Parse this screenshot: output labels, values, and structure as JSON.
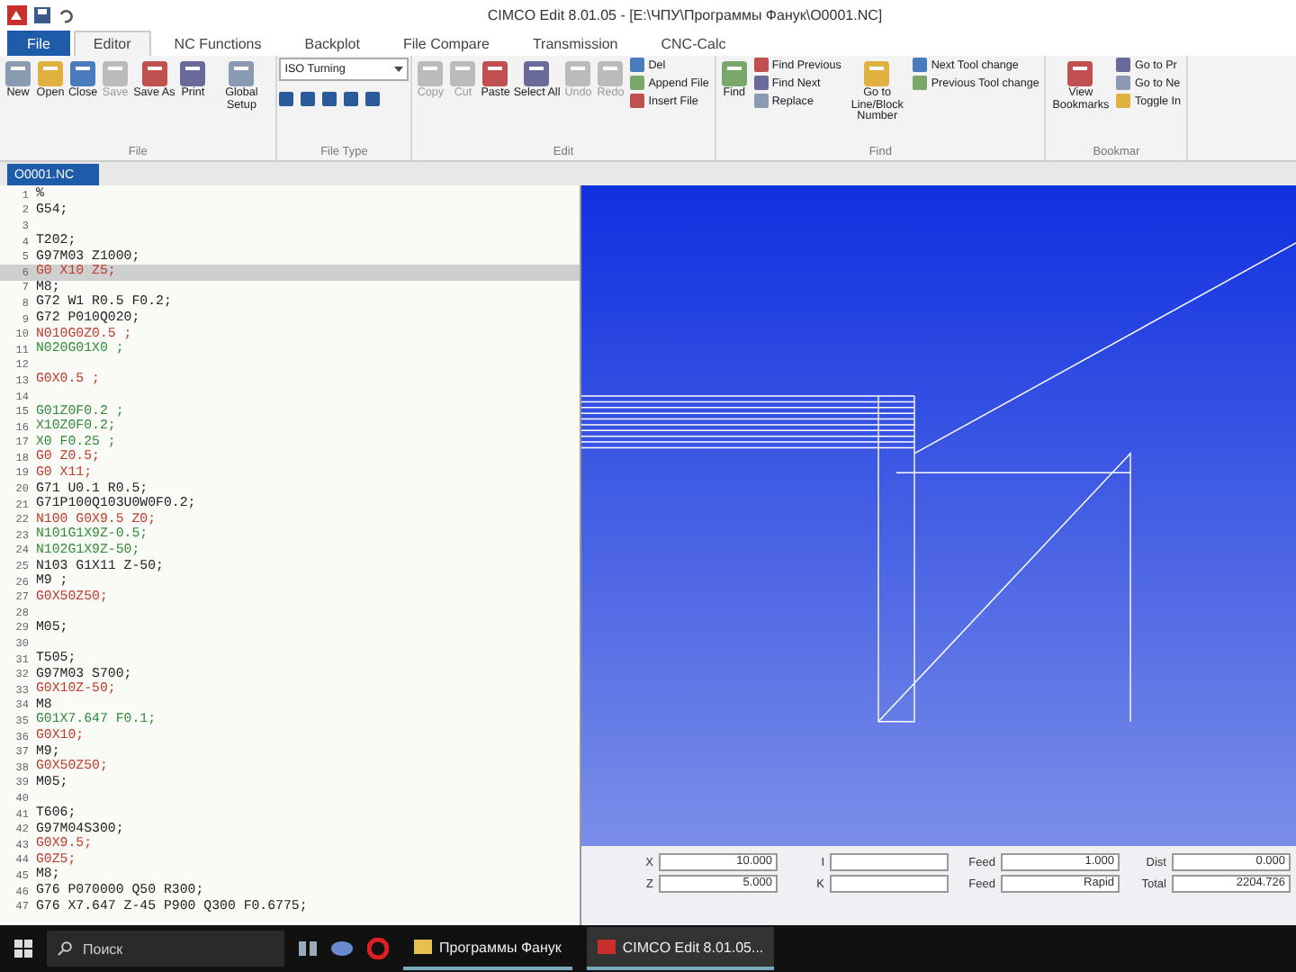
{
  "window": {
    "title": "CIMCO Edit 8.01.05 - [E:\\ЧПУ\\Программы Фанук\\O0001.NC]"
  },
  "tabs": [
    {
      "label": "File",
      "selected": false,
      "kind": "file"
    },
    {
      "label": "Editor",
      "selected": true,
      "kind": "tab"
    },
    {
      "label": "NC Functions",
      "selected": false,
      "kind": "tab"
    },
    {
      "label": "Backplot",
      "selected": false,
      "kind": "tab"
    },
    {
      "label": "File Compare",
      "selected": false,
      "kind": "tab"
    },
    {
      "label": "Transmission",
      "selected": false,
      "kind": "tab"
    },
    {
      "label": "CNC-Calc",
      "selected": false,
      "kind": "tab"
    }
  ],
  "ribbon": {
    "groups": [
      {
        "label": "File",
        "items": [
          {
            "kind": "large",
            "label": "New",
            "disabled": false
          },
          {
            "kind": "large",
            "label": "Open",
            "disabled": false
          },
          {
            "kind": "large",
            "label": "Close",
            "disabled": false
          },
          {
            "kind": "large",
            "label": "Save",
            "disabled": true
          },
          {
            "kind": "large",
            "label": "Save As",
            "disabled": false
          },
          {
            "kind": "large",
            "label": "Print",
            "disabled": false
          },
          {
            "kind": "large",
            "label": "Global Setup",
            "disabled": false
          }
        ]
      },
      {
        "label": "File Type",
        "items": [
          {
            "kind": "dropdown",
            "value": "ISO Turning"
          }
        ]
      },
      {
        "label": "Edit",
        "items": [
          {
            "kind": "large",
            "label": "Copy",
            "disabled": true
          },
          {
            "kind": "large",
            "label": "Cut",
            "disabled": true
          },
          {
            "kind": "large",
            "label": "Paste",
            "disabled": false
          },
          {
            "kind": "large",
            "label": "Select All",
            "disabled": false
          },
          {
            "kind": "large",
            "label": "Undo",
            "disabled": true
          },
          {
            "kind": "large",
            "label": "Redo",
            "disabled": true
          },
          {
            "kind": "small",
            "label": "Del",
            "disabled": false
          },
          {
            "kind": "small",
            "label": "Append File",
            "disabled": false
          },
          {
            "kind": "small",
            "label": "Insert File",
            "disabled": false
          }
        ]
      },
      {
        "label": "Find",
        "items": [
          {
            "kind": "large",
            "label": "Find",
            "disabled": false
          },
          {
            "kind": "small",
            "label": "Find Previous",
            "disabled": false
          },
          {
            "kind": "small",
            "label": "Find Next",
            "disabled": false
          },
          {
            "kind": "small",
            "label": "Replace",
            "disabled": false
          },
          {
            "kind": "large",
            "label": "Go to Line/Block Number",
            "disabled": false
          },
          {
            "kind": "small",
            "label": "Next Tool change",
            "disabled": false
          },
          {
            "kind": "small",
            "label": "Previous Tool change",
            "disabled": false
          }
        ]
      },
      {
        "label": "Bookmar",
        "items": [
          {
            "kind": "large",
            "label": "View Bookmarks",
            "disabled": false
          },
          {
            "kind": "small",
            "label": "Go to Pr",
            "disabled": false
          },
          {
            "kind": "small",
            "label": "Go to Ne",
            "disabled": false
          },
          {
            "kind": "small",
            "label": "Toggle In",
            "disabled": false
          }
        ]
      }
    ]
  },
  "document_tab": {
    "label": "O0001.NC"
  },
  "editor": {
    "lines": [
      {
        "number": "1",
        "text": "%",
        "kind": "plain",
        "selected": false
      },
      {
        "number": "2",
        "text": "G54;",
        "kind": "plain",
        "selected": false
      },
      {
        "number": "3",
        "selected": false
      },
      {
        "number": "4",
        "text": "T202;",
        "kind": "plain",
        "selected": false
      },
      {
        "number": "5",
        "text": "G97M03 Z1000;",
        "kind": "plain",
        "selected": false
      },
      {
        "number": "6",
        "text": "G0 X10 Z5;",
        "kind": "rapid",
        "selected": true
      },
      {
        "number": "7",
        "text": "M8;",
        "kind": "plain",
        "selected": false
      },
      {
        "number": "8",
        "text": "G72 W1 R0.5 F0.2;",
        "kind": "plain",
        "selected": false
      },
      {
        "number": "9",
        "text": "G72 P010Q020;",
        "kind": "plain",
        "selected": false
      },
      {
        "number": "10",
        "text": "N010G0Z0.5 ;",
        "kind": "rapid",
        "selected": false
      },
      {
        "number": "11",
        "text": "N020G01X0 ;",
        "kind": "feed",
        "selected": false
      },
      {
        "number": "12",
        "selected": false
      },
      {
        "number": "13",
        "text": "G0X0.5 ;",
        "kind": "rapid",
        "selected": false
      },
      {
        "number": "14",
        "selected": false
      },
      {
        "number": "15",
        "text": "G01Z0F0.2 ;",
        "kind": "feed",
        "selected": false
      },
      {
        "number": "16",
        "text": "X10Z0F0.2;",
        "kind": "feed",
        "selected": false
      },
      {
        "number": "17",
        "text": "X0 F0.25 ;",
        "kind": "feed",
        "selected": false
      },
      {
        "number": "18",
        "text": "G0 Z0.5;",
        "kind": "rapid",
        "selected": false
      },
      {
        "number": "19",
        "text": "G0 X11;",
        "kind": "rapid",
        "selected": false
      },
      {
        "number": "20",
        "text": "G71 U0.1 R0.5;",
        "kind": "plain",
        "selected": false
      },
      {
        "number": "21",
        "text": "G71P100Q103U0W0F0.2;",
        "kind": "plain",
        "selected": false
      },
      {
        "number": "22",
        "text": "N100 G0X9.5 Z0;",
        "kind": "rapid",
        "selected": false
      },
      {
        "number": "23",
        "text": "N101G1X9Z-0.5;",
        "kind": "feed",
        "selected": false
      },
      {
        "number": "24",
        "text": "N102G1X9Z-50;",
        "kind": "feed",
        "selected": false
      },
      {
        "number": "25",
        "text": "N103 G1X11 Z-50;",
        "kind": "plain",
        "selected": false
      },
      {
        "number": "26",
        "text": "M9 ;",
        "kind": "plain",
        "selected": false
      },
      {
        "number": "27",
        "text": "G0X50Z50;",
        "kind": "rapid",
        "selected": false
      },
      {
        "number": "28",
        "selected": false
      },
      {
        "number": "29",
        "text": "M05;",
        "kind": "plain",
        "selected": false
      },
      {
        "number": "30",
        "selected": false
      },
      {
        "number": "31",
        "text": "T505;",
        "kind": "plain",
        "selected": false
      },
      {
        "number": "32",
        "text": "G97M03 S700;",
        "kind": "plain",
        "selected": false
      },
      {
        "number": "33",
        "text": "G0X10Z-50;",
        "kind": "rapid",
        "selected": false
      },
      {
        "number": "34",
        "text": "M8",
        "kind": "plain",
        "selected": false
      },
      {
        "number": "35",
        "text": "G01X7.647 F0.1;",
        "kind": "feed",
        "selected": false
      },
      {
        "number": "36",
        "text": "G0X10;",
        "kind": "rapid",
        "selected": false
      },
      {
        "number": "37",
        "text": "M9;",
        "kind": "plain",
        "selected": false
      },
      {
        "number": "38",
        "text": "G0X50Z50;",
        "kind": "rapid",
        "selected": false
      },
      {
        "number": "39",
        "text": "M05;",
        "kind": "plain",
        "selected": false
      },
      {
        "number": "40",
        "selected": false
      },
      {
        "number": "41",
        "text": "T606;",
        "kind": "plain",
        "selected": false
      },
      {
        "number": "42",
        "text": "G97M04S300;",
        "kind": "plain",
        "selected": false
      },
      {
        "number": "43",
        "text": "G0X9.5;",
        "kind": "rapid",
        "selected": false
      },
      {
        "number": "44",
        "text": "G0Z5;",
        "kind": "rapid",
        "selected": false
      },
      {
        "number": "45",
        "text": "M8;",
        "kind": "plain",
        "selected": false
      },
      {
        "number": "46",
        "text": "G76 P070000 Q50 R300;",
        "kind": "plain",
        "selected": false
      },
      {
        "number": "47",
        "text": "G76 X7.647 Z-45 P900 Q300 F0.6775;",
        "kind": "plain",
        "selected": false
      }
    ]
  },
  "status_panel": {
    "fields": [
      {
        "label": "X",
        "value": "10.000"
      },
      {
        "label": "I"
      },
      {
        "label": "Feed",
        "value": "1.000"
      },
      {
        "label": "Dist",
        "value": "0.000"
      },
      {
        "label": "Z",
        "value": "5.000"
      },
      {
        "label": "K"
      },
      {
        "label": "Feed",
        "value": "Rapid"
      },
      {
        "label": "Total",
        "value": "2204.726"
      }
    ]
  },
  "taskbar": {
    "search": {
      "placeholder": "Поиск"
    },
    "apps": [
      {
        "label": "Программы Фанук",
        "selected": false
      },
      {
        "label": "CIMCO Edit 8.01.05...",
        "selected": true
      }
    ]
  }
}
